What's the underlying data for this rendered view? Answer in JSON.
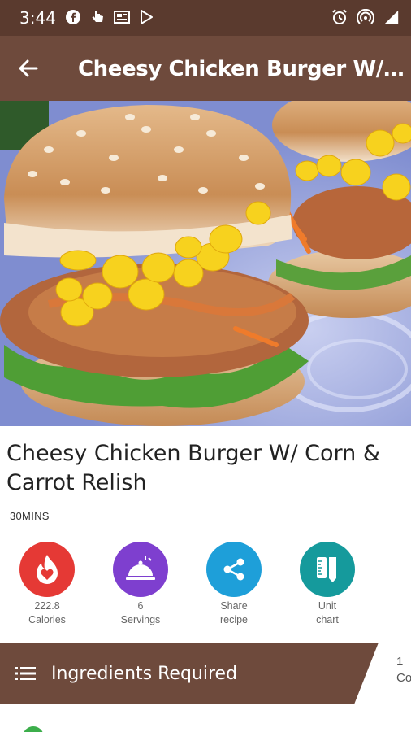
{
  "status_bar": {
    "time": "3:44",
    "left_icons": [
      "facebook-icon",
      "hand-icon",
      "news-icon",
      "play-store-icon"
    ],
    "right_icons": [
      "alarm-icon",
      "hotspot-icon",
      "signal-icon"
    ]
  },
  "app_bar": {
    "title": "Cheesy Chicken Burger W/ Corn & Carrot Relish",
    "back_icon": "arrow-back-icon"
  },
  "recipe": {
    "title": "Cheesy Chicken Burger W/ Corn & Carrot Relish",
    "time": "30MINS"
  },
  "stats": [
    {
      "icon": "flame-heart-icon",
      "color": "#e53935",
      "line1": "222.8",
      "line2": "Calories"
    },
    {
      "icon": "serving-dish-icon",
      "color": "#7e3fcf",
      "line1": "6",
      "line2": "Servings"
    },
    {
      "icon": "share-icon",
      "color": "#1e9fd9",
      "line1": "Share",
      "line2": "recipe"
    },
    {
      "icon": "ruler-icon",
      "color": "#159a9c",
      "line1": "Unit",
      "line2": "chart"
    }
  ],
  "ingredients_bar": {
    "label": "Ingredients Required",
    "right_line1": "1",
    "right_line2": "Co"
  }
}
